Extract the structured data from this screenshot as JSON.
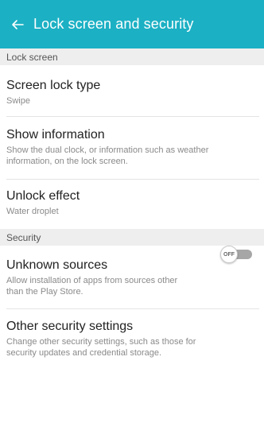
{
  "header": {
    "title": "Lock screen and security",
    "back_icon": "back-arrow-icon",
    "background": "#1cb0c4"
  },
  "sections": [
    {
      "label": "Lock screen"
    },
    {
      "label": "Security"
    }
  ],
  "items": [
    {
      "title": "Screen lock type",
      "subtitle": "Swipe"
    },
    {
      "title": "Show information",
      "subtitle_line1": "Show the dual clock, or information such as weather",
      "subtitle_line2": "information, on the lock screen."
    },
    {
      "title": "Unlock effect",
      "subtitle": "Water droplet"
    },
    {
      "title": "Unknown sources",
      "subtitle_line1": "Allow installation of apps from sources other",
      "subtitle_line2": "than the Play Store.",
      "toggle_label": "OFF",
      "toggle_on": false
    },
    {
      "title": "Other security settings",
      "subtitle_line1": "Change other security settings, such as those for",
      "subtitle_line2": "security updates and credential storage."
    }
  ]
}
